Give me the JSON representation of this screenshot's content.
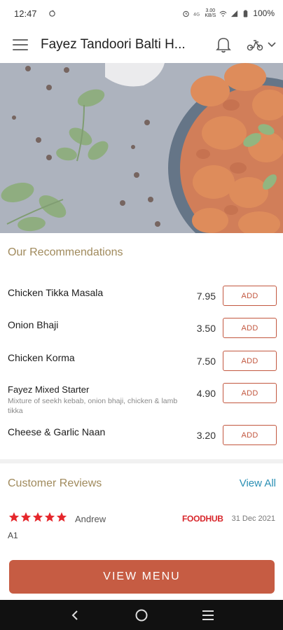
{
  "status_bar": {
    "time": "12:47",
    "battery": "100%",
    "network_top": "3.00",
    "network_bottom": "KB/S"
  },
  "app_bar": {
    "title": "Fayez Tandoori Balti H...",
    "icons": [
      "menu-icon",
      "bell-icon",
      "scooter-icon",
      "chevron-down-icon"
    ]
  },
  "recommendations": {
    "title": "Our Recommendations",
    "add_label": "ADD",
    "items": [
      {
        "name": "Chicken Tikka Masala",
        "description": "",
        "price": "7.95"
      },
      {
        "name": "Onion Bhaji",
        "description": "",
        "price": "3.50"
      },
      {
        "name": "Chicken Korma",
        "description": "",
        "price": "7.50"
      },
      {
        "name": "Fayez Mixed Starter",
        "description": "Mixture of seekh kebab, onion bhaji, chicken & lamb tikka",
        "price": "4.90"
      },
      {
        "name": "Cheese & Garlic Naan",
        "description": "",
        "price": "3.20"
      }
    ]
  },
  "reviews": {
    "title": "Customer Reviews",
    "view_all": "View All",
    "items": [
      {
        "rating": 5,
        "name": "Andrew",
        "source": "FOODHUB",
        "date": "31 Dec 2021",
        "text": "A1"
      }
    ]
  },
  "cta": {
    "label": "VIEW MENU"
  },
  "colors": {
    "accent": "#c65c43",
    "section_title": "#a08a5c",
    "link": "#2a8fb4",
    "star": "#e5262b"
  }
}
